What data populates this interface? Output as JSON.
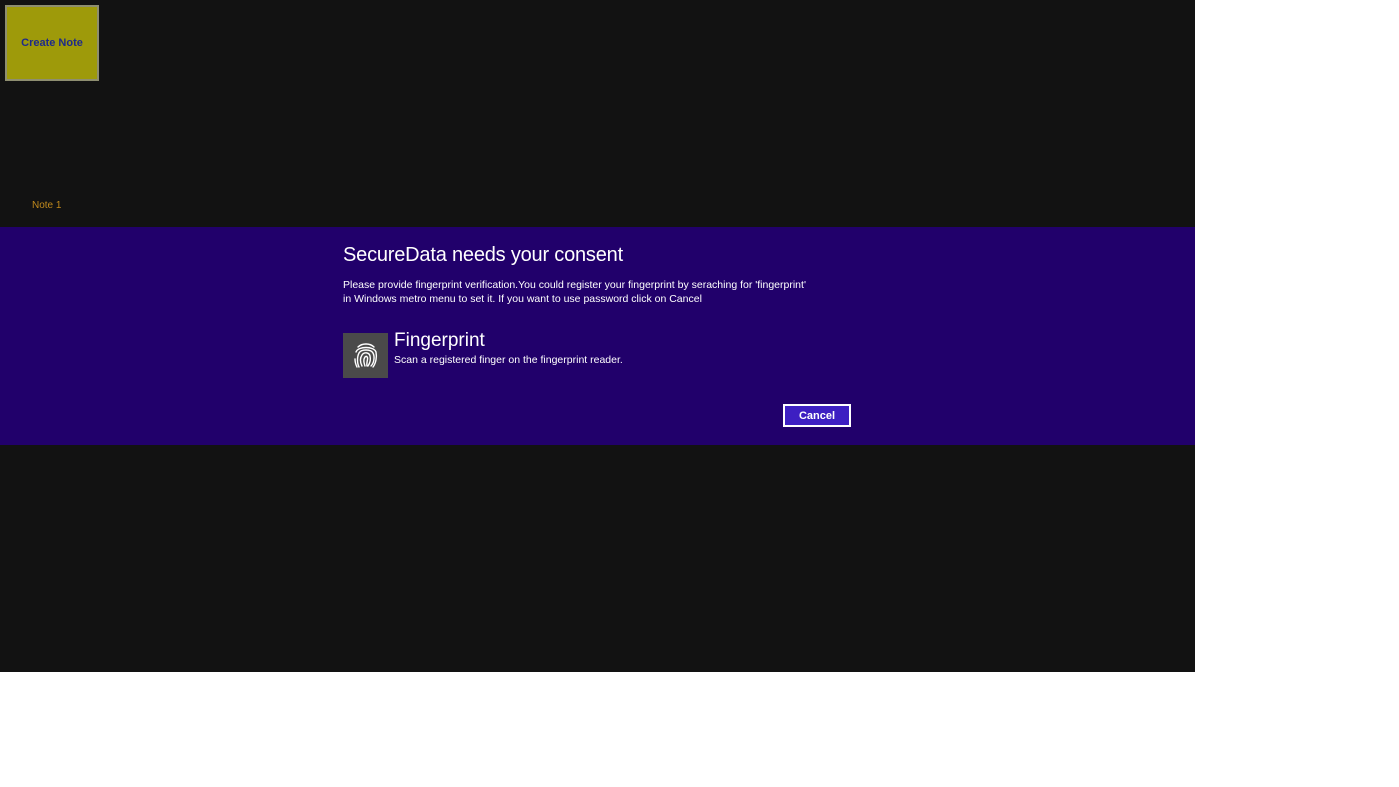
{
  "app": {
    "create_note_label": "Create Note",
    "notes": [
      {
        "label": "Note 1"
      }
    ]
  },
  "consent_dialog": {
    "title": "SecureData needs your consent",
    "message_line1": "Please provide fingerprint verification.You could register your fingerprint by seraching for 'fingerprint'",
    "message_line2": "in Windows metro menu to set it. If you want to use password click on Cancel",
    "method_title": "Fingerprint",
    "method_subtitle": "Scan a registered finger on the fingerprint reader.",
    "method_icon": "fingerprint-icon",
    "cancel_label": "Cancel"
  },
  "colors": {
    "app_background": "#121212",
    "tile_background": "#9e9a0a",
    "tile_text": "#1e2a8a",
    "note_text": "#c0891c",
    "dialog_background": "#21006b",
    "cancel_background": "#3d1fc2"
  }
}
